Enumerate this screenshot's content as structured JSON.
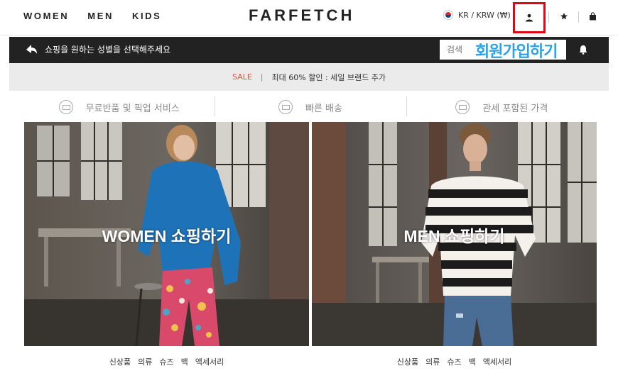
{
  "header": {
    "nav": [
      "WOMEN",
      "MEN",
      "KIDS"
    ],
    "logo": "FARFETCH",
    "region": "KR / KRW (₩)",
    "icons": {
      "account": "user-icon",
      "wishlist": "star-icon",
      "bag": "bag-icon"
    }
  },
  "bar": {
    "gender_prompt": "쇼핑을 원하는 성별을 선택해주세요",
    "search_placeholder": "검색",
    "signup_overlay": "회원가입하기",
    "icons": {
      "prompt": "arrow-icon",
      "notifications": "bell-icon"
    }
  },
  "banner": {
    "sale": "SALE",
    "separator": "|",
    "text": "최대 60% 할인 : 세일 브랜드 추가"
  },
  "services": [
    {
      "label": "무료반품 및 픽업 서비스",
      "icon": "return-icon"
    },
    {
      "label": "빠른 배송",
      "icon": "delivery-icon"
    },
    {
      "label": "관세 포함된 가격",
      "icon": "duties-icon"
    }
  ],
  "hero": {
    "women": {
      "label": "WOMEN 쇼핑하기",
      "categories": [
        "신상품",
        "의류",
        "슈즈",
        "백",
        "액세서리"
      ]
    },
    "men": {
      "label": "MEN 쇼핑하기",
      "categories": [
        "신상품",
        "의류",
        "슈즈",
        "백",
        "액세서리"
      ]
    }
  },
  "colors": {
    "dark_bar": "#222222",
    "sale_red": "#e84e3c",
    "highlight_box": "#e30613",
    "overlay_text": "#29a3e6",
    "banner_bg": "#ebebeb"
  }
}
